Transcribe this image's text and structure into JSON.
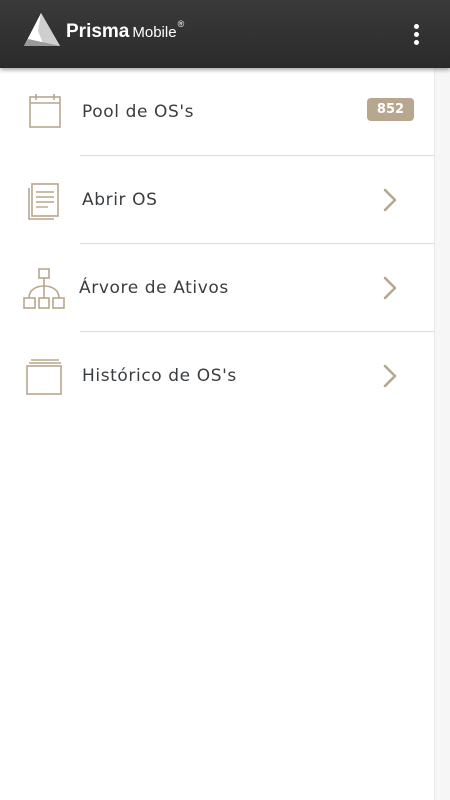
{
  "header": {
    "brand_bold": "Prisma",
    "brand_light": "Mobile",
    "brand_mark": "®",
    "logo_icon": "prisma-triangle-logo",
    "menu_icon": "more-vertical-icon"
  },
  "menu": {
    "items": [
      {
        "label": "Pool de OS's",
        "icon": "calendar-icon",
        "badge": "852"
      },
      {
        "label": "Abrir OS",
        "icon": "document-icon",
        "chevron": "chevron-right-icon"
      },
      {
        "label": "Árvore de Ativos",
        "icon": "asset-tree-icon",
        "chevron": "chevron-right-icon"
      },
      {
        "label": "Histórico de OS's",
        "icon": "history-stack-icon",
        "chevron": "chevron-right-icon"
      }
    ]
  },
  "colors": {
    "appbar": "#2f2f2f",
    "accent": "#b7a78e",
    "text": "#3a3d40",
    "divider": "#dcdcdc"
  }
}
